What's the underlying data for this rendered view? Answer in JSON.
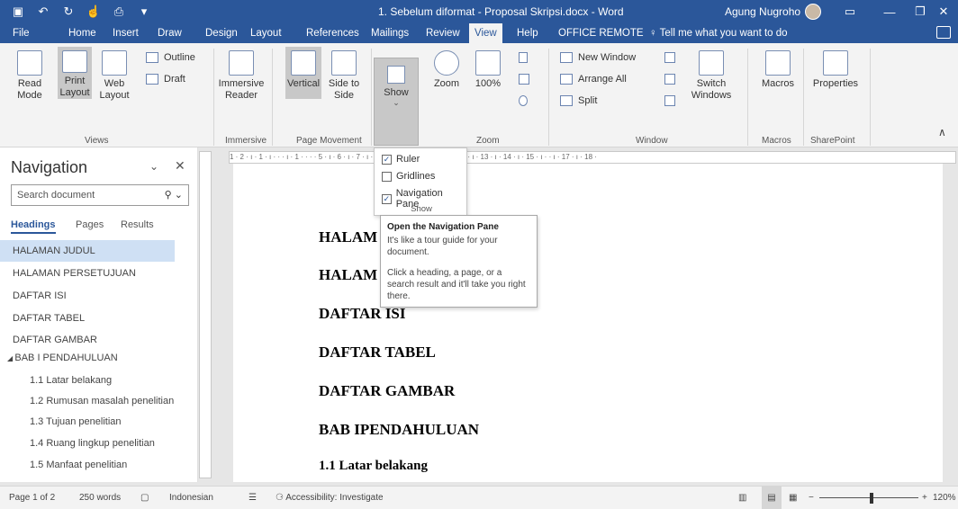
{
  "titlebar": {
    "qat": [
      "save-icon",
      "undo-icon",
      "redo-icon",
      "touch-mode-icon",
      "print-preview-icon",
      "customize-icon"
    ],
    "title": "1. Sebelum diformat - Proposal Skripsi.docx  -  Word",
    "user": "Agung Nugroho",
    "controls": [
      "ribbon-display-icon",
      "minimize-icon",
      "restore-icon",
      "close-icon"
    ]
  },
  "tabs": [
    "File",
    "Home",
    "Insert",
    "Draw",
    "Design",
    "Layout",
    "References",
    "Mailings",
    "Review",
    "View",
    "Help",
    "OFFICE REMOTE"
  ],
  "active_tab": "View",
  "tell_me": "Tell me what you want to do",
  "ribbon": {
    "views": {
      "read_mode": "Read Mode",
      "print_layout": "Print Layout",
      "web_layout": "Web Layout",
      "outline": "Outline",
      "draft": "Draft",
      "label": "Views"
    },
    "immersive": {
      "reader": "Immersive Reader",
      "label": "Immersive"
    },
    "page_movement": {
      "vertical": "Vertical",
      "side": "Side to Side",
      "label": "Page Movement"
    },
    "show": {
      "label": "Show"
    },
    "zoom": {
      "zoom": "Zoom",
      "hundred": "100%",
      "label": "Zoom"
    },
    "window": {
      "new_window": "New Window",
      "arrange_all": "Arrange All",
      "split": "Split",
      "switch": "Switch Windows",
      "label": "Window"
    },
    "macros": {
      "macros": "Macros",
      "label": "Macros"
    },
    "sharepoint": {
      "properties": "Properties",
      "label": "SharePoint"
    }
  },
  "show_dropdown": {
    "items": [
      {
        "label": "Ruler",
        "checked": true
      },
      {
        "label": "Gridlines",
        "checked": false
      },
      {
        "label": "Navigation Pane",
        "checked": true
      }
    ],
    "label": "Show"
  },
  "tooltip": {
    "title": "Open the Navigation Pane",
    "line1": "It's like a tour guide for your document.",
    "line2": "Click a heading, a page, or a search result and it'll take you right there."
  },
  "navigation": {
    "title": "Navigation",
    "search_placeholder": "Search document",
    "tabs": [
      "Headings",
      "Pages",
      "Results"
    ],
    "headings": [
      "HALAMAN JUDUL",
      "HALAMAN PERSETUJUAN",
      "DAFTAR ISI",
      "DAFTAR TABEL",
      "DAFTAR GAMBAR",
      "BAB I PENDAHULUAN",
      "1.1 Latar belakang",
      "1.2 Rumusan masalah penelitian",
      "1.3 Tujuan penelitian",
      "1.4 Ruang lingkup penelitian",
      "1.5 Manfaat penelitian"
    ]
  },
  "ruler_text": "1 · 2 · ı · 1 · ı · · · ı · 1 ·    ·  ·  · 5 · ı · 6 · ı · 7 · ı · 8 · ı · 9 · ı · 10 · ı · 11 · ı · 12 · ı · 13 · ı · 14 · ı · 15 · ı ·   · ı · 17 · ı · 18 ·",
  "document": {
    "headings": [
      "HALAM",
      "HALAM",
      "DAFTAR ISI",
      "DAFTAR TABEL",
      "DAFTAR GAMBAR",
      "BAB IPENDAHULUAN"
    ],
    "subheading": "1.1 Latar belakang"
  },
  "statusbar": {
    "page": "Page 1 of 2",
    "words": "250 words",
    "language": "Indonesian",
    "accessibility": "Accessibility: Investigate",
    "zoom": "120%",
    "zoom_minus": "−",
    "zoom_plus": "+"
  },
  "colors": {
    "accent": "#2b579a"
  }
}
